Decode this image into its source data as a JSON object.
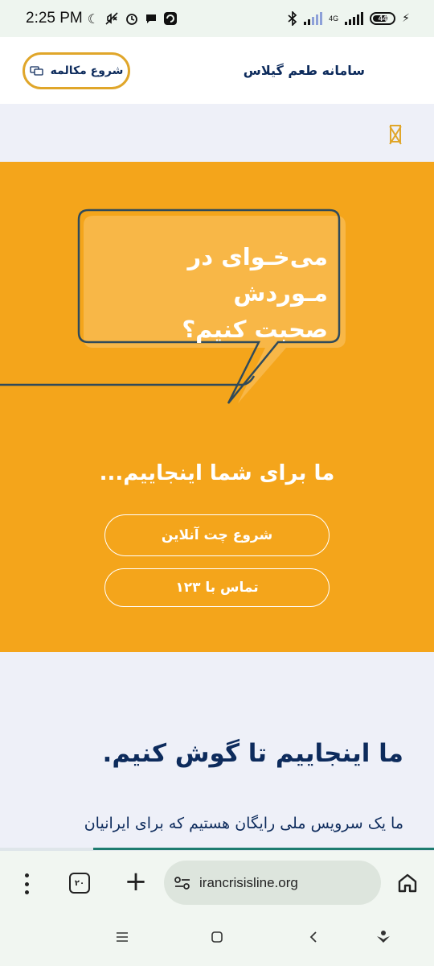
{
  "status_bar": {
    "time": "2:25 PM",
    "network": "4G",
    "battery": "44"
  },
  "header": {
    "site_title": "سامانه طعم گیلاس",
    "call_button": "شروع مکالمه"
  },
  "hero": {
    "bubble_line1": "می‌خـوای در مـوردش",
    "bubble_line2": "صحبت کنیم؟",
    "heading": "ما برای شما اینجاییم...",
    "chat_button": "شروع چت آنلاین",
    "call_button": "تماس با ۱۲۳"
  },
  "content": {
    "title": "ما اینجاییم تا گوش کنیم.",
    "paragraph": "ما یک سرویس ملی رایگان هستیم که برای ایرانیان"
  },
  "browser": {
    "tab_count": "۲۰",
    "url": "irancrisisline.org"
  },
  "colors": {
    "brand_orange": "#f4a51b",
    "navy": "#0d2b5c",
    "accent_gold": "#e0a62a"
  }
}
